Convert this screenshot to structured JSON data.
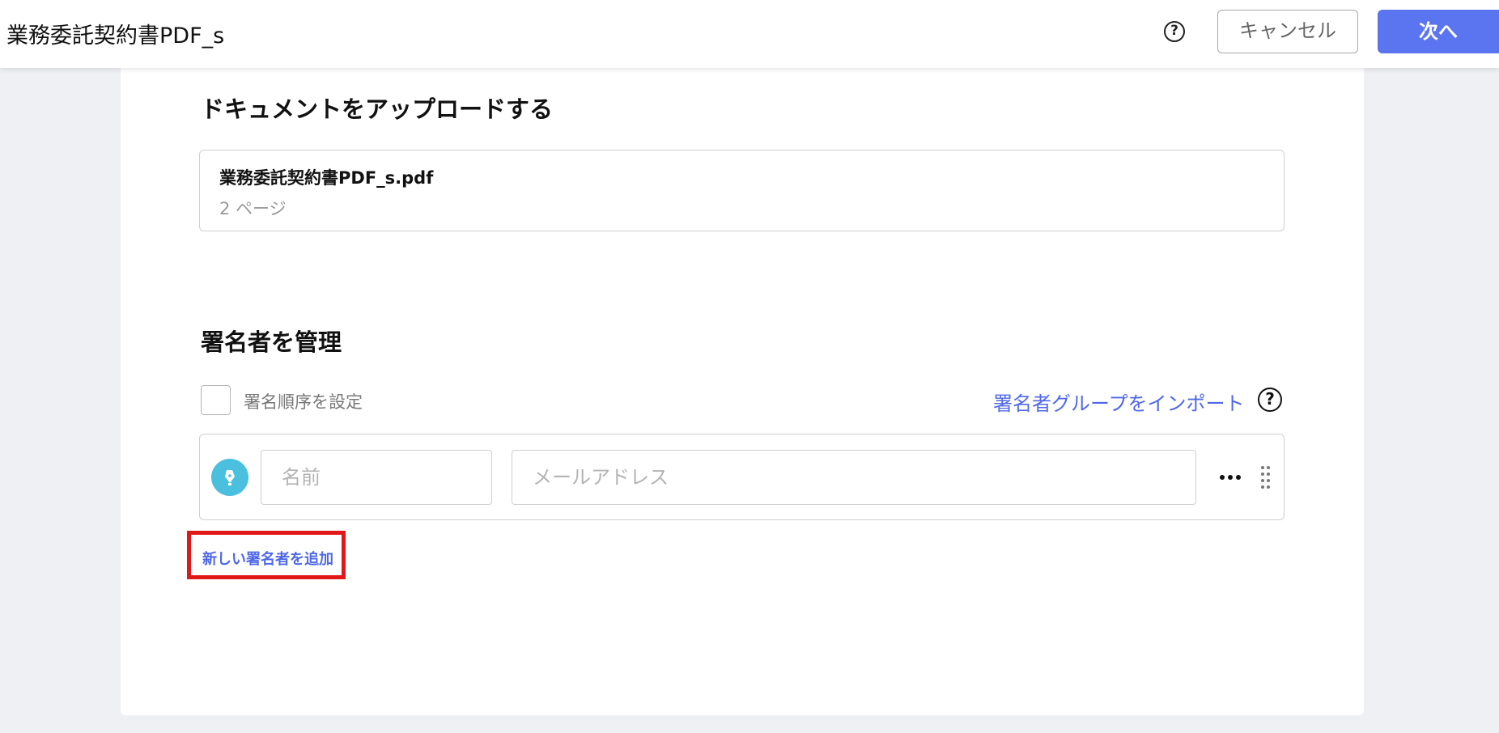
{
  "header": {
    "document_title": "業務委託契約書PDF_s",
    "help_symbol": "?",
    "cancel_label": "キャンセル",
    "next_label": "次へ"
  },
  "upload": {
    "title": "ドキュメントをアップロードする",
    "file_name": "業務委託契約書PDF_s.pdf",
    "page_count": "2 ページ"
  },
  "signers": {
    "title": "署名者を管理",
    "signing_order_label": "署名順序を設定",
    "signing_order_checked": false,
    "import_group_label": "署名者グループをインポート",
    "help_symbol": "?",
    "rows": [
      {
        "name_placeholder": "名前",
        "email_placeholder": "メールアドレス",
        "name_value": "",
        "email_value": ""
      }
    ],
    "add_signer_label": "新しい署名者を追加"
  },
  "icons": {
    "help": "help-circle-icon",
    "signer": "pen-nib-icon",
    "more": "more-horizontal-icon",
    "drag": "drag-handle-icon"
  },
  "colors": {
    "primary": "#5b75f0",
    "link": "#4f68e8",
    "signer_avatar": "#4bbfde",
    "highlight": "#e01818",
    "background": "#eef0f4"
  }
}
